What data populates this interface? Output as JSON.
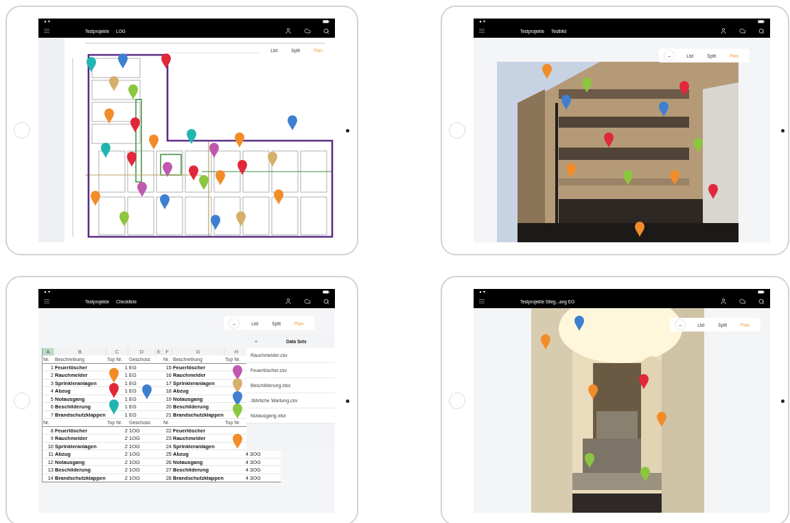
{
  "tablets": [
    {
      "breadcrumbs": [
        "Testprojekte",
        "LOG"
      ],
      "view_switch": {
        "options": [
          {
            "label": "List",
            "selected": false
          },
          {
            "label": "Split",
            "selected": false
          },
          {
            "label": "Plan",
            "selected": true
          }
        ]
      },
      "content": {
        "kind": "floorplan"
      },
      "pins": [
        {
          "color": "#22b5b0"
        },
        {
          "color": "#3f7fd0"
        },
        {
          "color": "#e0283a"
        },
        {
          "color": "#d4b06a"
        },
        {
          "color": "#8cc63f"
        },
        {
          "color": "#f28c28"
        },
        {
          "color": "#e0283a"
        },
        {
          "color": "#3f7fd0"
        },
        {
          "color": "#22b5b0"
        },
        {
          "color": "#f28c28"
        },
        {
          "color": "#22b5b0"
        },
        {
          "color": "#c058b0"
        },
        {
          "color": "#f28c28"
        },
        {
          "color": "#e0283a"
        },
        {
          "color": "#d4b06a"
        },
        {
          "color": "#c058b0"
        },
        {
          "color": "#e0283a"
        },
        {
          "color": "#e0283a"
        },
        {
          "color": "#8cc63f"
        },
        {
          "color": "#f28c28"
        },
        {
          "color": "#c058b0"
        },
        {
          "color": "#f28c28"
        },
        {
          "color": "#3f7fd0"
        },
        {
          "color": "#f28c28"
        },
        {
          "color": "#8cc63f"
        },
        {
          "color": "#3f7fd0"
        },
        {
          "color": "#d4b06a"
        }
      ]
    },
    {
      "breadcrumbs": [
        "Testprojekte",
        "Testbild"
      ],
      "view_switch": {
        "collapse": "–",
        "options": [
          {
            "label": "List",
            "selected": false
          },
          {
            "label": "Split",
            "selected": false
          },
          {
            "label": "Plan",
            "selected": true
          }
        ]
      },
      "content": {
        "kind": "picture"
      },
      "pins": [
        {
          "color": "#f28c28"
        },
        {
          "color": "#8cc63f"
        },
        {
          "color": "#e0283a"
        },
        {
          "color": "#3f7fd0"
        },
        {
          "color": "#3f7fd0"
        },
        {
          "color": "#e0283a"
        },
        {
          "color": "#8cc63f"
        },
        {
          "color": "#f28c28"
        },
        {
          "color": "#8cc63f"
        },
        {
          "color": "#f28c28"
        },
        {
          "color": "#e0283a"
        },
        {
          "color": "#f28c28"
        }
      ]
    },
    {
      "breadcrumbs": [
        "Testprojekte",
        "Checkliste"
      ],
      "view_switch": {
        "collapse": "–",
        "options": [
          {
            "label": "List",
            "selected": false
          },
          {
            "label": "Split",
            "selected": false
          },
          {
            "label": "Plan",
            "selected": true
          }
        ]
      },
      "content": {
        "kind": "spreadsheet",
        "column_letters": [
          {
            "label": "A",
            "selected": true
          },
          {
            "label": "B",
            "selected": false
          },
          {
            "label": "C",
            "selected": false
          },
          {
            "label": "D",
            "selected": false
          },
          {
            "label": "E",
            "selected": false
          },
          {
            "label": "F",
            "selected": false
          },
          {
            "label": "G",
            "selected": false
          },
          {
            "label": "H",
            "selected": false
          }
        ],
        "rows": [
          {
            "kind": "header",
            "cells": [
              "Nr.",
              "Beschreibung",
              "Top Nr.",
              "Geschoss",
              null,
              "Nr.",
              "Beschreibung",
              "Top Nr.",
              null
            ]
          },
          {
            "kind": "item",
            "cells": [
              "1",
              "Feuerlöscher",
              "1",
              "EG",
              null,
              "15",
              "Feuerlöscher",
              null,
              null
            ]
          },
          {
            "kind": "item",
            "cells": [
              "2",
              "Rauchmelder",
              "1",
              "EG",
              null,
              "16",
              "Rauchmelder",
              null,
              null
            ]
          },
          {
            "kind": "item",
            "cells": [
              "3",
              "Sprinkleranlagen",
              "1",
              "EG",
              null,
              "17",
              "Sprinkleranlagen",
              null,
              null
            ]
          },
          {
            "kind": "item",
            "cells": [
              "4",
              "Abzug",
              "1",
              "EG",
              null,
              "18",
              "Abzug",
              null,
              null
            ]
          },
          {
            "kind": "item",
            "cells": [
              "5",
              "Notausgang",
              "1",
              "EG",
              null,
              "19",
              "Notausgang",
              null,
              null
            ]
          },
          {
            "kind": "item",
            "cells": [
              "6",
              "Beschilderung",
              "1",
              "EG",
              null,
              "20",
              "Beschilderung",
              null,
              null
            ]
          },
          {
            "kind": "item",
            "cells": [
              "7",
              "Brandschutzklappen",
              "1",
              "EG",
              null,
              "21",
              "Brandschutzklappen",
              null,
              null
            ]
          },
          {
            "kind": "header",
            "cells": [
              "Nr.",
              null,
              "Top Nr.",
              "Geschoss",
              null,
              "Nr.",
              null,
              "Top Nr.",
              null
            ]
          },
          {
            "kind": "item",
            "cells": [
              "8",
              "Feuerlöscher",
              "2",
              "1OG",
              null,
              "22",
              "Feuerlöscher",
              null,
              null
            ]
          },
          {
            "kind": "item",
            "cells": [
              "9",
              "Rauchmelder",
              "2",
              "1OG",
              null,
              "23",
              "Rauchmelder",
              null,
              null
            ]
          },
          {
            "kind": "item",
            "cells": [
              "10",
              "Sprinkleranlagen",
              "2",
              "1OG",
              null,
              "24",
              "Sprinkleranlagen",
              null,
              null
            ]
          },
          {
            "kind": "item",
            "cells": [
              "11",
              "Abzug",
              "2",
              "1OG",
              null,
              "25",
              "Abzug",
              "4",
              "3OG"
            ]
          },
          {
            "kind": "item",
            "cells": [
              "12",
              "Notausgang",
              "2",
              "1OG",
              null,
              "26",
              "Notausgang",
              "4",
              "3OG"
            ]
          },
          {
            "kind": "item",
            "cells": [
              "13",
              "Beschilderung",
              "2",
              "1OG",
              null,
              "27",
              "Beschilderung",
              "4",
              "3OG"
            ]
          },
          {
            "kind": "item",
            "cells": [
              "14",
              "Brandschutzklappen",
              "2",
              "1OG",
              null,
              "28",
              "Brandschutzklappen",
              "4",
              "3OG"
            ]
          }
        ],
        "data_sets": {
          "close": "×",
          "title": "Data Sets",
          "items": [
            "Rauchmelder.csv",
            "Feuerlöscher.csv",
            "Beschilderung.xlsx",
            "Jährliche Wartung.csv",
            "Notausgang.xlsx"
          ]
        }
      },
      "pins": [
        {
          "color": "#f28c28"
        },
        {
          "color": "#e0283a"
        },
        {
          "color": "#3f7fd0"
        },
        {
          "color": "#22b5b0"
        },
        {
          "color": "#c058b0"
        },
        {
          "color": "#d4b06a"
        },
        {
          "color": "#3f7fd0"
        },
        {
          "color": "#8cc63f"
        },
        {
          "color": "#f28c28"
        }
      ]
    },
    {
      "breadcrumbs": [
        "Testprojekte Stieg...ang EG"
      ],
      "view_switch": {
        "collapse": "–",
        "options": [
          {
            "label": "List",
            "selected": false
          },
          {
            "label": "Split",
            "selected": false
          },
          {
            "label": "Plan",
            "selected": true
          }
        ]
      },
      "content": {
        "kind": "picture"
      },
      "pins": [
        {
          "color": "#3f7fd0"
        },
        {
          "color": "#f28c28"
        },
        {
          "color": "#e0283a"
        },
        {
          "color": "#f28c28"
        },
        {
          "color": "#f28c28"
        },
        {
          "color": "#8cc63f"
        },
        {
          "color": "#8cc63f"
        }
      ]
    }
  ]
}
